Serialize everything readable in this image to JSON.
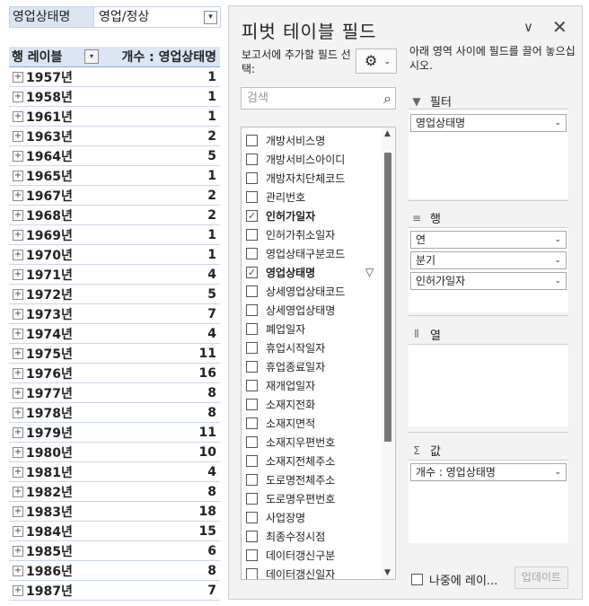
{
  "report_filter": {
    "label": "영업상태명",
    "value": "영업/정상",
    "dropdown_glyph": "▾"
  },
  "pivot_table": {
    "row_header": "행 레이블",
    "value_header": "개수 : 영업상태명",
    "rows": [
      {
        "year": "1957년",
        "count": "1"
      },
      {
        "year": "1958년",
        "count": "1"
      },
      {
        "year": "1961년",
        "count": "1"
      },
      {
        "year": "1963년",
        "count": "2"
      },
      {
        "year": "1964년",
        "count": "5"
      },
      {
        "year": "1965년",
        "count": "1"
      },
      {
        "year": "1967년",
        "count": "2"
      },
      {
        "year": "1968년",
        "count": "2"
      },
      {
        "year": "1969년",
        "count": "1"
      },
      {
        "year": "1970년",
        "count": "1"
      },
      {
        "year": "1971년",
        "count": "4"
      },
      {
        "year": "1972년",
        "count": "5"
      },
      {
        "year": "1973년",
        "count": "7"
      },
      {
        "year": "1974년",
        "count": "4"
      },
      {
        "year": "1975년",
        "count": "11"
      },
      {
        "year": "1976년",
        "count": "16"
      },
      {
        "year": "1977년",
        "count": "8"
      },
      {
        "year": "1978년",
        "count": "8"
      },
      {
        "year": "1979년",
        "count": "11"
      },
      {
        "year": "1980년",
        "count": "10"
      },
      {
        "year": "1981년",
        "count": "4"
      },
      {
        "year": "1982년",
        "count": "8"
      },
      {
        "year": "1983년",
        "count": "18"
      },
      {
        "year": "1984년",
        "count": "15"
      },
      {
        "year": "1985년",
        "count": "6"
      },
      {
        "year": "1986년",
        "count": "8"
      },
      {
        "year": "1987년",
        "count": "7"
      }
    ]
  },
  "pane": {
    "title": "피벗 테이블 필드",
    "choose_label": "보고서에 추가할 필드 선택:",
    "drag_hint": "아래 영역 사이에 필드를 끌어 놓으십시오.",
    "search_placeholder": "검색",
    "fields": [
      {
        "name": "개방서비스명",
        "checked": false
      },
      {
        "name": "개방서비스아이디",
        "checked": false
      },
      {
        "name": "개방자치단체코드",
        "checked": false
      },
      {
        "name": "관리번호",
        "checked": false
      },
      {
        "name": "인허가일자",
        "checked": true
      },
      {
        "name": "인허가취소일자",
        "checked": false
      },
      {
        "name": "영업상태구분코드",
        "checked": false
      },
      {
        "name": "영업상태명",
        "checked": true,
        "filtered": true
      },
      {
        "name": "상세영업상태코드",
        "checked": false
      },
      {
        "name": "상세영업상태명",
        "checked": false
      },
      {
        "name": "폐업일자",
        "checked": false
      },
      {
        "name": "휴업시작일자",
        "checked": false
      },
      {
        "name": "휴업종료일자",
        "checked": false
      },
      {
        "name": "재개업일자",
        "checked": false
      },
      {
        "name": "소재지전화",
        "checked": false
      },
      {
        "name": "소재지면적",
        "checked": false
      },
      {
        "name": "소재지우편번호",
        "checked": false
      },
      {
        "name": "소재지전체주소",
        "checked": false
      },
      {
        "name": "도로명전체주소",
        "checked": false
      },
      {
        "name": "도로명우편번호",
        "checked": false
      },
      {
        "name": "사업장명",
        "checked": false
      },
      {
        "name": "최종수정시점",
        "checked": false
      },
      {
        "name": "데이터갱신구분",
        "checked": false
      },
      {
        "name": "데이터갱신일자",
        "checked": false
      }
    ],
    "areas": {
      "filters": {
        "label": "필터",
        "items": [
          "영업상태명"
        ]
      },
      "rows": {
        "label": "행",
        "items": [
          "연",
          "분기",
          "인허가일자"
        ]
      },
      "columns": {
        "label": "열",
        "items": []
      },
      "values": {
        "label": "값",
        "items": [
          "개수 : 영업상태명"
        ]
      }
    },
    "defer_label": "나중에 레이...",
    "update_label": "업데이트"
  }
}
